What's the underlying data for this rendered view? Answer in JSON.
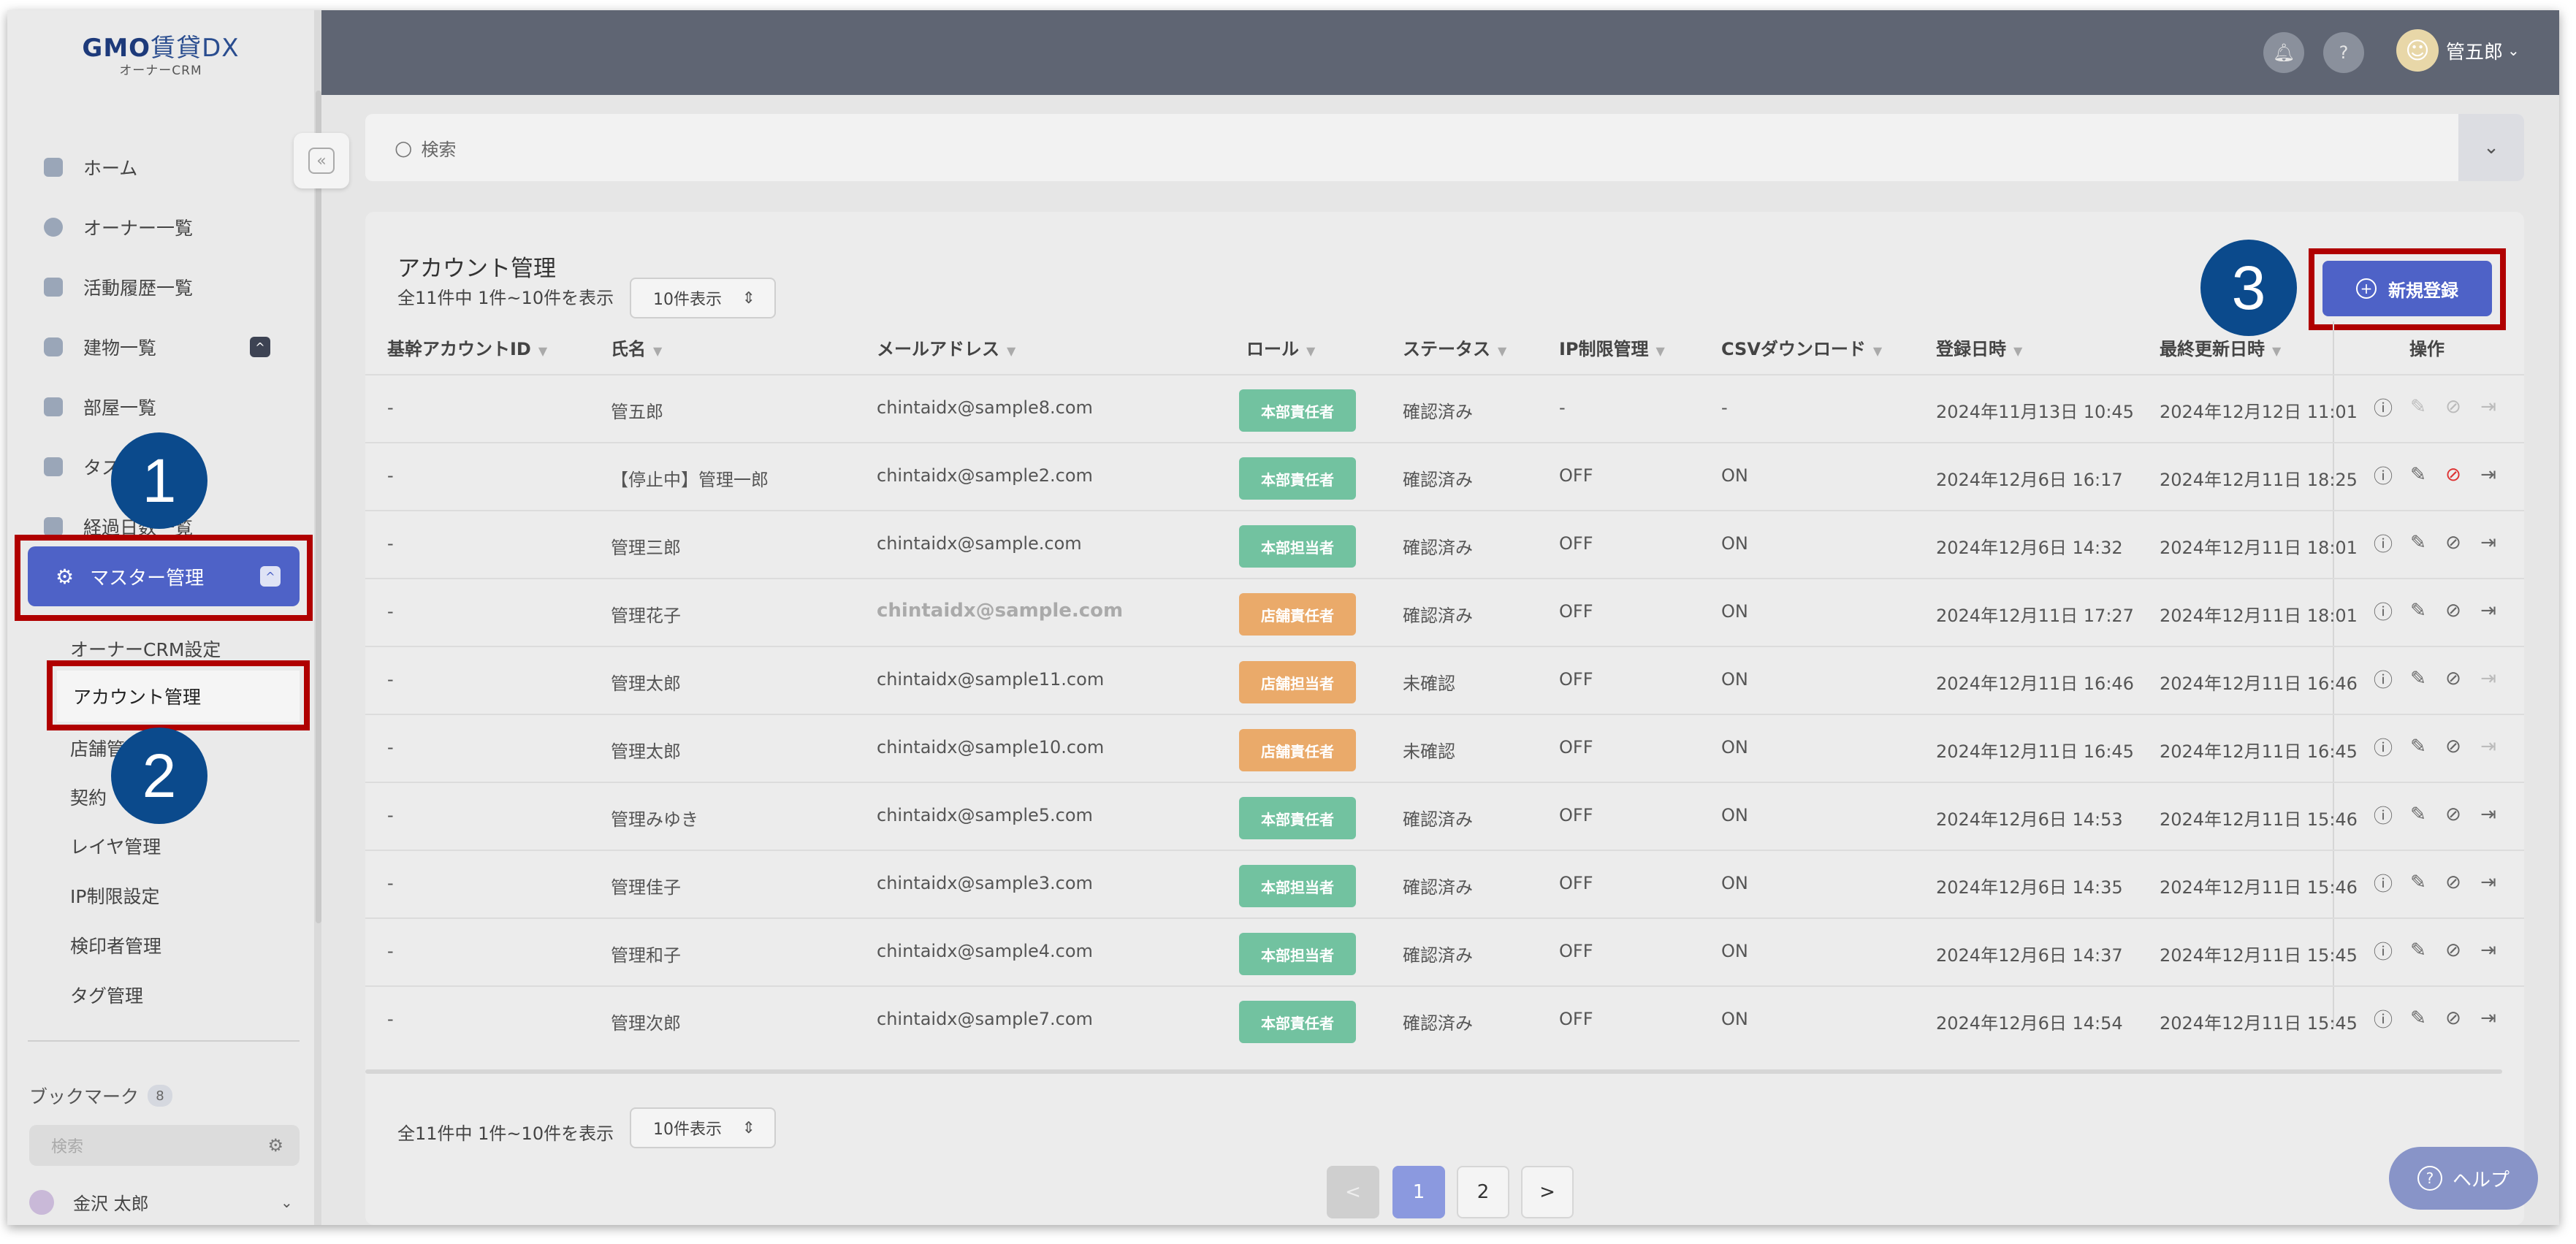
{
  "logo": {
    "brand": "GMO",
    "product": "賃貸DX",
    "sub": "オーナーCRM"
  },
  "sidebar": {
    "items": [
      {
        "label": "ホーム"
      },
      {
        "label": "オーナー一覧"
      },
      {
        "label": "活動履歴一覧"
      },
      {
        "label": "建物一覧",
        "badge": "^"
      },
      {
        "label": "部屋一覧"
      },
      {
        "label": "タス"
      },
      {
        "label": "経過日数一覧"
      }
    ],
    "active": {
      "label": "マスター管理",
      "badge": "^"
    },
    "subitems": [
      {
        "label": "オーナーCRM設定"
      },
      {
        "label": "アカウント管理"
      },
      {
        "label": "店舗管理"
      },
      {
        "label": "契約"
      },
      {
        "label": "レイヤ管理"
      },
      {
        "label": "IP制限設定"
      },
      {
        "label": "検印者管理"
      },
      {
        "label": "タグ管理"
      }
    ],
    "bookmark_label": "ブックマーク",
    "bookmark_count": "8",
    "search_placeholder": "検索",
    "user_name": "金沢 太郎"
  },
  "header": {
    "user_name": "管五郎"
  },
  "search": {
    "placeholder": "検索"
  },
  "panel": {
    "title": "アカウント管理",
    "count_text": "全11件中 1件~10件を表示",
    "per_page": "10件表示",
    "new_button": "新規登録"
  },
  "callouts": [
    "1",
    "2",
    "3"
  ],
  "table": {
    "columns": [
      "基幹アカウントID",
      "氏名",
      "メールアドレス",
      "ロール",
      "ステータス",
      "IP制限管理",
      "CSVダウンロード",
      "登録日時",
      "最終更新日時",
      "操作"
    ],
    "rows": [
      {
        "id": "-",
        "name": "管五郎",
        "email": "chintaidx@sample8.com",
        "role": "本部責任者",
        "status": "確認済み",
        "ip": "-",
        "csv": "-",
        "created": "2024年11月13日 10:45",
        "updated": "2024年12月12日 11:01"
      },
      {
        "id": "-",
        "name": "【停止中】管理一郎",
        "email": "chintaidx@sample2.com",
        "role": "本部責任者",
        "status": "確認済み",
        "ip": "OFF",
        "csv": "ON",
        "created": "2024年12月6日 16:17",
        "updated": "2024年12月11日 18:25"
      },
      {
        "id": "-",
        "name": "管理三郎",
        "email": "chintaidx@sample.com",
        "role": "本部担当者",
        "status": "確認済み",
        "ip": "OFF",
        "csv": "ON",
        "created": "2024年12月6日 14:32",
        "updated": "2024年12月11日 18:01"
      },
      {
        "id": "-",
        "name": "管理花子",
        "email": "chintaidx@sample.com",
        "role": "店舗責任者",
        "status": "確認済み",
        "ip": "OFF",
        "csv": "ON",
        "created": "2024年12月11日 17:27",
        "updated": "2024年12月11日 18:01"
      },
      {
        "id": "-",
        "name": "管理太郎",
        "email": "chintaidx@sample11.com",
        "role": "店舗担当者",
        "status": "未確認",
        "ip": "OFF",
        "csv": "ON",
        "created": "2024年12月11日 16:46",
        "updated": "2024年12月11日 16:46"
      },
      {
        "id": "-",
        "name": "管理太郎",
        "email": "chintaidx@sample10.com",
        "role": "店舗責任者",
        "status": "未確認",
        "ip": "OFF",
        "csv": "ON",
        "created": "2024年12月11日 16:45",
        "updated": "2024年12月11日 16:45"
      },
      {
        "id": "-",
        "name": "管理みゆき",
        "email": "chintaidx@sample5.com",
        "role": "本部責任者",
        "status": "確認済み",
        "ip": "OFF",
        "csv": "ON",
        "created": "2024年12月6日 14:53",
        "updated": "2024年12月11日 15:46"
      },
      {
        "id": "-",
        "name": "管理佳子",
        "email": "chintaidx@sample3.com",
        "role": "本部担当者",
        "status": "確認済み",
        "ip": "OFF",
        "csv": "ON",
        "created": "2024年12月6日 14:35",
        "updated": "2024年12月11日 15:46"
      },
      {
        "id": "-",
        "name": "管理和子",
        "email": "chintaidx@sample4.com",
        "role": "本部担当者",
        "status": "確認済み",
        "ip": "OFF",
        "csv": "ON",
        "created": "2024年12月6日 14:37",
        "updated": "2024年12月11日 15:45"
      },
      {
        "id": "-",
        "name": "管理次郎",
        "email": "chintaidx@sample7.com",
        "role": "本部責任者",
        "status": "確認済み",
        "ip": "OFF",
        "csv": "ON",
        "created": "2024年12月6日 14:54",
        "updated": "2024年12月11日 15:45"
      }
    ]
  },
  "pagination": {
    "prev": "<",
    "pages": [
      "1",
      "2"
    ],
    "next": ">"
  },
  "help_label": "ヘルプ",
  "colors": {
    "primary": "#4e62c7",
    "header": "#5f6573",
    "role_green": "#72c2a0",
    "role_orange": "#eaaa6a",
    "callout": "#0b4a8c",
    "highlight": "#b00000"
  }
}
